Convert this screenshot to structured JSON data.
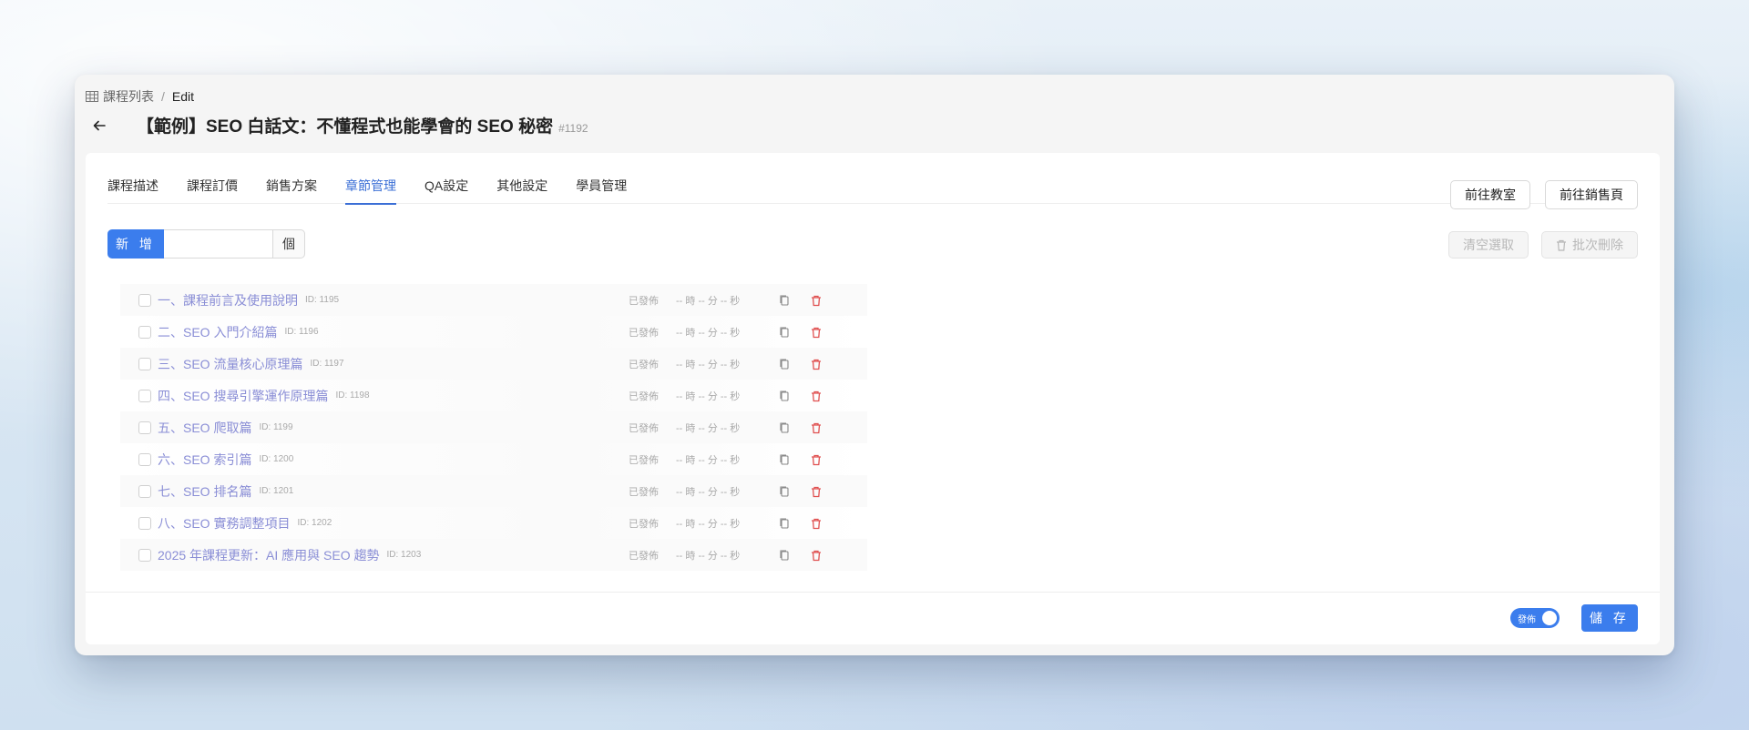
{
  "breadcrumb": {
    "parent": "課程列表",
    "separator": "/",
    "current": "Edit"
  },
  "header": {
    "title": "【範例】SEO 白話文：不懂程式也能學會的 SEO 秘密",
    "id": "#1192"
  },
  "tabs": [
    {
      "label": "課程描述"
    },
    {
      "label": "課程訂價"
    },
    {
      "label": "銷售方案"
    },
    {
      "label": "章節管理",
      "active": true
    },
    {
      "label": "QA設定"
    },
    {
      "label": "其他設定"
    },
    {
      "label": "學員管理"
    }
  ],
  "top_buttons": {
    "classroom": "前往教室",
    "sales_page": "前往銷售頁"
  },
  "add": {
    "button": "新 增",
    "input_value": "",
    "suffix": "個"
  },
  "actions": {
    "clear_selection": "清空選取",
    "batch_delete": "批次刪除"
  },
  "chapters": [
    {
      "title": "一、課程前言及使用說明",
      "id": "ID: 1195",
      "status": "已發佈",
      "duration": "-- 時 -- 分 -- 秒"
    },
    {
      "title": "二、SEO 入門介紹篇",
      "id": "ID: 1196",
      "status": "已發佈",
      "duration": "-- 時 -- 分 -- 秒"
    },
    {
      "title": "三、SEO 流量核心原理篇",
      "id": "ID: 1197",
      "status": "已發佈",
      "duration": "-- 時 -- 分 -- 秒"
    },
    {
      "title": "四、SEO 搜尋引擎運作原理篇",
      "id": "ID: 1198",
      "status": "已發佈",
      "duration": "-- 時 -- 分 -- 秒"
    },
    {
      "title": "五、SEO 爬取篇",
      "id": "ID: 1199",
      "status": "已發佈",
      "duration": "-- 時 -- 分 -- 秒"
    },
    {
      "title": "六、SEO 索引篇",
      "id": "ID: 1200",
      "status": "已發佈",
      "duration": "-- 時 -- 分 -- 秒"
    },
    {
      "title": "七、SEO 排名篇",
      "id": "ID: 1201",
      "status": "已發佈",
      "duration": "-- 時 -- 分 -- 秒"
    },
    {
      "title": "八、SEO 實務調整項目",
      "id": "ID: 1202",
      "status": "已發佈",
      "duration": "-- 時 -- 分 -- 秒"
    },
    {
      "title": "2025 年課程更新：AI 應用與 SEO 趨勢",
      "id": "ID: 1203",
      "status": "已發佈",
      "duration": "-- 時 -- 分 -- 秒"
    }
  ],
  "footer": {
    "publish_toggle_label": "發佈",
    "publish_on": true,
    "save": "儲 存"
  },
  "icons": {
    "breadcrumb": "table-icon",
    "back": "arrow-left-icon",
    "copy": "copy-icon",
    "delete": "trash-icon"
  },
  "colors": {
    "accent": "#3b7ded",
    "link": "#8a8ed6",
    "delete": "#e05050"
  }
}
